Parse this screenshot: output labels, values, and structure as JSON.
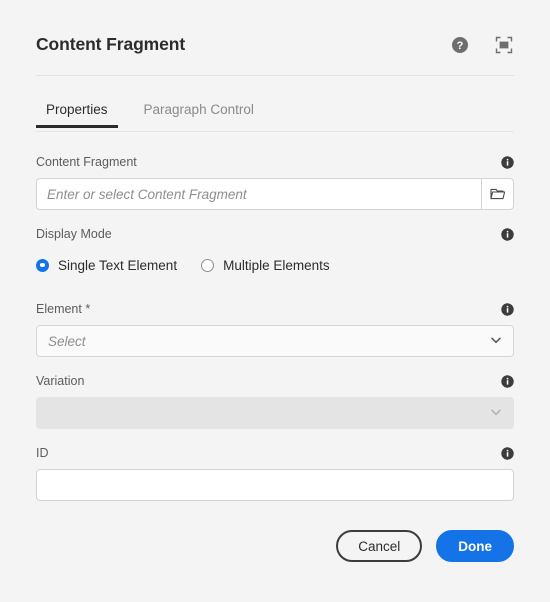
{
  "header": {
    "title": "Content Fragment",
    "help_icon": "help-circle-icon",
    "fullscreen_icon": "fullscreen-icon"
  },
  "tabs": [
    {
      "label": "Properties",
      "active": true
    },
    {
      "label": "Paragraph Control",
      "active": false
    }
  ],
  "fields": {
    "content_fragment": {
      "label": "Content Fragment",
      "placeholder": "Enter or select Content Fragment",
      "value": "",
      "browse_icon": "folder-icon",
      "info_icon": "info-icon"
    },
    "display_mode": {
      "label": "Display Mode",
      "info_icon": "info-icon",
      "options": [
        {
          "label": "Single Text Element",
          "selected": true
        },
        {
          "label": "Multiple Elements",
          "selected": false
        }
      ]
    },
    "element": {
      "label": "Element *",
      "placeholder": "Select",
      "value": "",
      "chevron_icon": "chevron-down-icon",
      "info_icon": "info-icon"
    },
    "variation": {
      "label": "Variation",
      "value": "",
      "disabled": true,
      "chevron_icon": "chevron-down-icon",
      "info_icon": "info-icon"
    },
    "id": {
      "label": "ID",
      "value": "",
      "placeholder": "",
      "info_icon": "info-icon"
    }
  },
  "footer": {
    "cancel_label": "Cancel",
    "done_label": "Done"
  },
  "colors": {
    "accent_blue": "#1473e6",
    "background": "#f4f4f4",
    "text_dark": "#2c2c2c",
    "text_label": "#5c5c5c",
    "placeholder": "#8e8e8e",
    "disabled_fill": "#e4e4e4"
  }
}
